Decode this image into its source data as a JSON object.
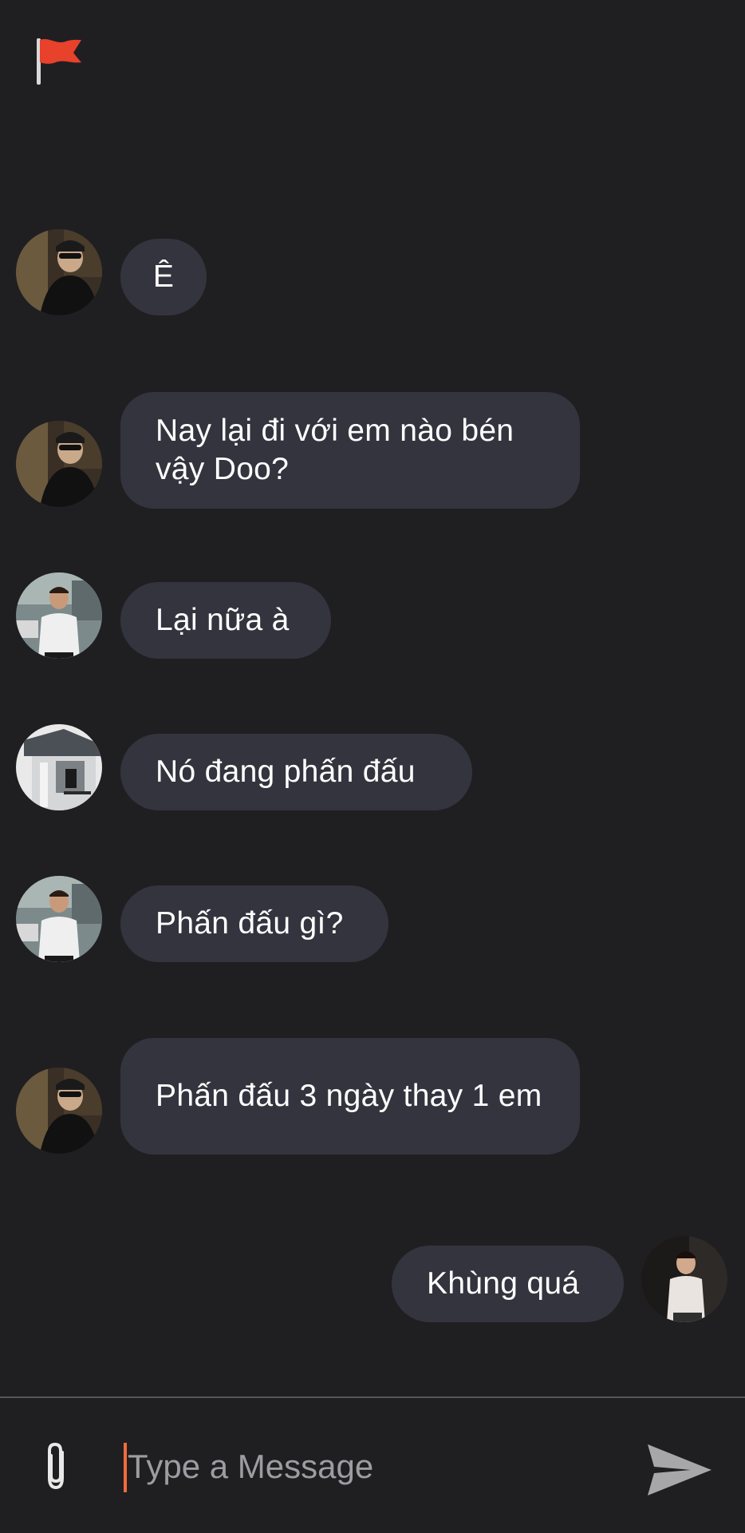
{
  "header": {
    "flag_icon": "report-flag-icon"
  },
  "messages": [
    {
      "sender": "incoming",
      "avatar": "avatar-sunglasses",
      "text": "Ê"
    },
    {
      "sender": "incoming",
      "avatar": "avatar-sunglasses",
      "text": "Nay lại đi với em nào bén vậy Doo?"
    },
    {
      "sender": "incoming",
      "avatar": "avatar-white-shirt",
      "text": "Lại nữa à"
    },
    {
      "sender": "incoming",
      "avatar": "avatar-building",
      "text": "Nó đang phấn đấu"
    },
    {
      "sender": "incoming",
      "avatar": "avatar-white-shirt",
      "text": "Phấn đấu gì?"
    },
    {
      "sender": "incoming",
      "avatar": "avatar-sunglasses",
      "text": "Phấn đấu 3 ngày thay 1 em"
    },
    {
      "sender": "outgoing",
      "avatar": "avatar-me",
      "text": "Khùng quá"
    }
  ],
  "composer": {
    "placeholder": "Type a Message",
    "value": "",
    "attach_icon": "paperclip-icon",
    "send_icon": "send-icon"
  },
  "colors": {
    "background": "#1f1f22",
    "bubble": "#34343f",
    "caret": "#f26b3a",
    "flag": "#e8412c"
  }
}
